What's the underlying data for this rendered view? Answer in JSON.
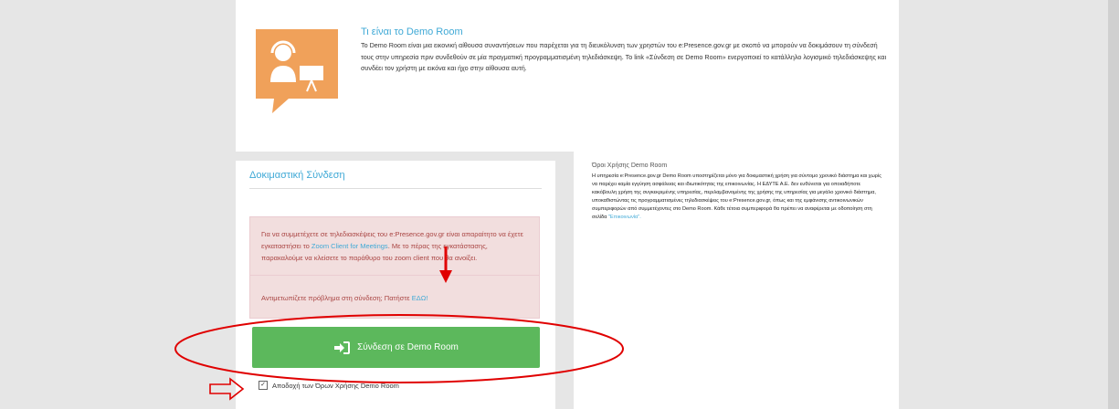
{
  "top": {
    "title": "Τι είναι το Demo Room",
    "text": "Το Demo Room είναι μια εικονική αίθουσα συναντήσεων που παρέχεται για τη διευκόλυνση των χρηστών του e:Presence.gov.gr με σκοπό να μπορούν να δοκιμάσουν τη σύνδεσή τους στην υπηρεσία πριν συνδεθούν σε μία πραγματική προγραμματισμένη τηλεδιάσκεψη. Το link «Σύνδεση σε Demo Room» ενεργοποιεί το κατάλληλο λογισμικό τηλεδιάσκεψης και συνδέει τον χρήστη με εικόνα και ήχο στην αίθουσα αυτή."
  },
  "left": {
    "title": "Δοκιμαστική Σύνδεση",
    "alert1_pre": "Για να συμμετέχετε σε τηλεδιασκέψεις του e:Presence.gov.gr είναι απαραίτητο να έχετε εγκαταστήσει το ",
    "alert1_link": "Zoom Client for Meetings",
    "alert1_post": ". Με το πέρας της εγκατάστασης, παρακαλούμε να κλείσετε το παράθυρο του zoom client που θα ανοίξει.",
    "alert2_pre": "Αντιμετωπίζετε πρόβλημα στη σύνδεση; Πατήστε ",
    "alert2_link": "ΕΔΩ!",
    "connect_label": "Σύνδεση σε Demo Room",
    "accept_label": "Αποδοχή των Όρων Χρήσης Demo Room",
    "accept_checked": true
  },
  "terms": {
    "title": "Όροι Χρήσης Demo Room",
    "text": "Η υπηρεσία e:Presence.gov.gr Demo Room υποστηρίζεται μόνο για δοκιμαστική χρήση για σύντομο χρονικό διάστημα και χωρίς να παρέχει καμία εγγύηση ασφάλειας και ιδιωτικότητας της επικοινωνίας. Η ΕΔΥΤΕ Α.Ε. δεν ευθύνεται για οποιαδήποτε κακόβουλη χρήση της συγκεκριμένης υπηρεσίας, περιλαμβανομένης της χρήσης της υπηρεσίας για μεγάλο χρονικό διάστημα, υποκαθιστώντας τις προγραμματισμένες τηλεδιασκέψεις του e:Presence.gov.gr, όπως και της εμφάνισης αντικοινωνικών συμπεριφορών από συμμετέχοντες στο Demo Room. Κάθε τέτοια συμπεριφορά θα πρέπει να αναφέρεται με οδοποίηση στη σελίδα ",
    "link": "\"Επικοινωνία\"."
  },
  "colors": {
    "accent": "#3fa9d6",
    "button": "#5cb85c",
    "alert_bg": "#f2dede",
    "annotation": "#e00000",
    "icon_orange": "#f0a15a"
  }
}
